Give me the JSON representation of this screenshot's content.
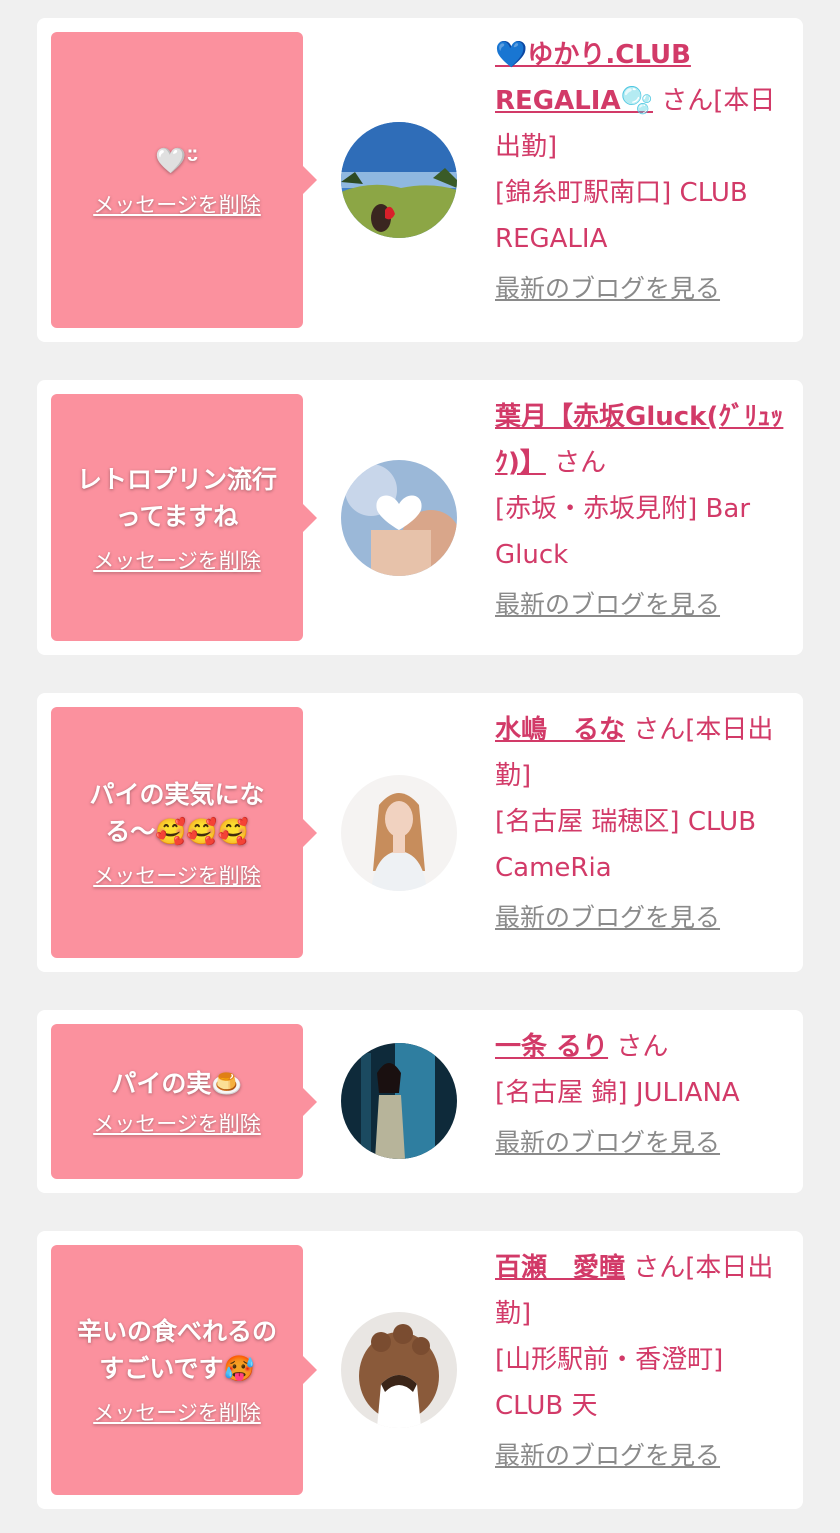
{
  "delete_label": "メッセージを削除",
  "blog_label": "最新のブログを見る",
  "san_label": "さん",
  "messages": [
    {
      "message": "🤍ᵕ̈",
      "name": "💙ゆかり.CLUB REGALIA🫧",
      "suffix": "さん[本日出勤]",
      "shop": "[錦糸町駅南口] CLUB REGALIA",
      "avatar_icon": "avatar-park-photo"
    },
    {
      "message": "レトロプリン流行ってますね",
      "name": "葉月【赤坂Gluck(ｸﾞﾘｭｯｸ)】",
      "suffix": "さん",
      "shop": "[赤坂・赤坂見附] Bar Gluck",
      "avatar_icon": "avatar-heart-photo"
    },
    {
      "message": "パイの実気になる〜🥰🥰🥰",
      "name": "水嶋　るな",
      "suffix": "さん[本日出勤]",
      "shop": "[名古屋 瑞穂区] CLUB CameRia",
      "avatar_icon": "avatar-portrait-photo"
    },
    {
      "message": "パイの実🍮",
      "name": "一条 るり",
      "suffix": "さん",
      "shop": "[名古屋 錦] JULIANA",
      "avatar_icon": "avatar-dress-photo"
    },
    {
      "message": "辛いの食べれるのすごいです🥵",
      "name": "百瀬　愛瞳",
      "suffix": "さん[本日出勤]",
      "shop": "[山形駅前・香澄町] CLUB 天",
      "avatar_icon": "avatar-hair-photo"
    }
  ],
  "colors": {
    "bubble": "#fb919e",
    "accent": "#d23a68",
    "link_gray": "#8a8a8a",
    "background": "#f0f0f0"
  }
}
